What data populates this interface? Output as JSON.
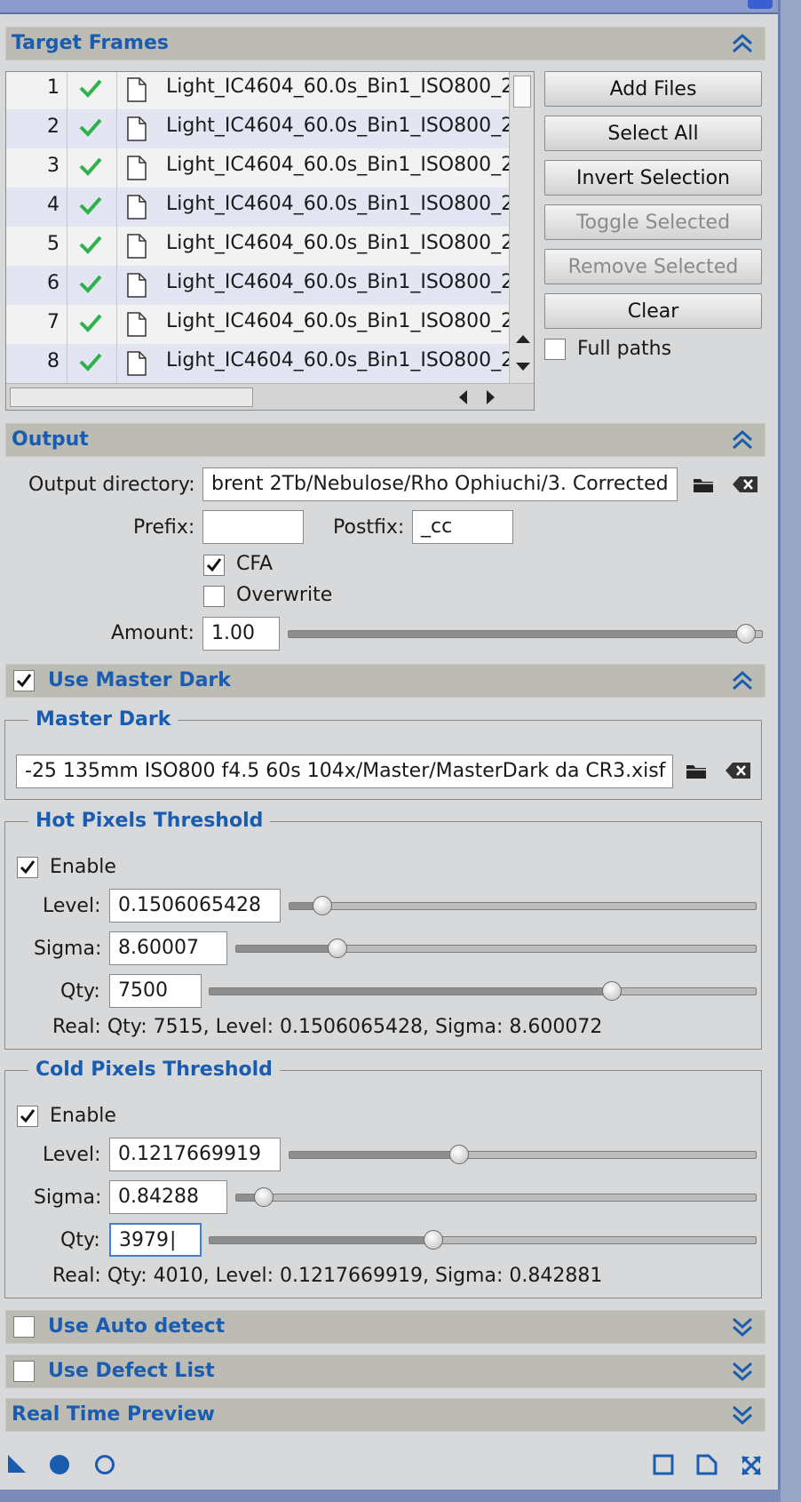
{
  "target_frames": {
    "title": "Target Frames",
    "files": [
      {
        "index": "1",
        "name": "Light_IC4604_60.0s_Bin1_ISO800_2"
      },
      {
        "index": "2",
        "name": "Light_IC4604_60.0s_Bin1_ISO800_2"
      },
      {
        "index": "3",
        "name": "Light_IC4604_60.0s_Bin1_ISO800_2"
      },
      {
        "index": "4",
        "name": "Light_IC4604_60.0s_Bin1_ISO800_2"
      },
      {
        "index": "5",
        "name": "Light_IC4604_60.0s_Bin1_ISO800_2"
      },
      {
        "index": "6",
        "name": "Light_IC4604_60.0s_Bin1_ISO800_2"
      },
      {
        "index": "7",
        "name": "Light_IC4604_60.0s_Bin1_ISO800_2"
      },
      {
        "index": "8",
        "name": "Light_IC4604_60.0s_Bin1_ISO800_2"
      }
    ],
    "buttons": {
      "add_files": "Add Files",
      "select_all": "Select All",
      "invert_selection": "Invert Selection",
      "toggle_selected": "Toggle Selected",
      "remove_selected": "Remove Selected",
      "clear": "Clear"
    },
    "full_paths_label": "Full paths",
    "full_paths_checked": false
  },
  "output": {
    "title": "Output",
    "directory_label": "Output directory:",
    "directory_value": "brent 2Tb/Nebulose/Rho Ophiuchi/3. Corrected",
    "prefix_label": "Prefix:",
    "prefix_value": "",
    "postfix_label": "Postfix:",
    "postfix_value": "_cc",
    "cfa_label": "CFA",
    "cfa_checked": true,
    "overwrite_label": "Overwrite",
    "overwrite_checked": false,
    "amount_label": "Amount:",
    "amount_value": "1.00",
    "amount_fraction": 1.0
  },
  "use_master_dark": {
    "title": "Use Master Dark",
    "checked": true,
    "master_dark_group": "Master Dark",
    "master_dark_path": "-25 135mm ISO800 f4.5 60s 104x/Master/MasterDark da CR3.xisf"
  },
  "hot_pixels": {
    "title": "Hot Pixels Threshold",
    "enable_label": "Enable",
    "enabled": true,
    "level_label": "Level:",
    "level_value": "0.1506065428",
    "level_fraction": 0.07,
    "sigma_label": "Sigma:",
    "sigma_value": "8.60007",
    "sigma_fraction": 0.195,
    "qty_label": "Qty:",
    "qty_value": "7500",
    "qty_fraction": 0.735,
    "real_text": "Real: Qty: 7515, Level: 0.1506065428, Sigma: 8.600072"
  },
  "cold_pixels": {
    "title": "Cold Pixels Threshold",
    "enable_label": "Enable",
    "enabled": true,
    "level_label": "Level:",
    "level_value": "0.1217669919",
    "level_fraction": 0.363,
    "sigma_label": "Sigma:",
    "sigma_value": "0.84288",
    "sigma_fraction": 0.052,
    "qty_label": "Qty:",
    "qty_value": "3979",
    "qty_fraction": 0.408,
    "real_text": "Real: Qty: 4010, Level: 0.1217669919, Sigma: 0.842881"
  },
  "collapsed_sections": {
    "auto_detect": "Use Auto detect",
    "auto_detect_checked": false,
    "defect_list": "Use Defect List",
    "defect_list_checked": false,
    "real_time_preview": "Real Time Preview"
  },
  "colors": {
    "section_title": "#1a5db0",
    "check_green": "#2fb24a",
    "accent": "#3e7fd9"
  }
}
